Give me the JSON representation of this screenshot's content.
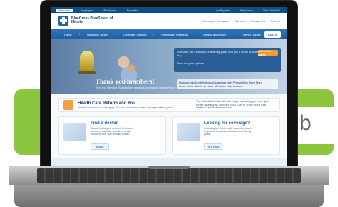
{
  "banner": {
    "letter": "b",
    "colors": {
      "green": "#8cc63f",
      "blue": "#1e5fa3"
    }
  },
  "browser": {
    "top_tabs": [
      "Welcome",
      "Employers",
      "Producers",
      "Providers"
    ],
    "top_right_links": [
      "en Español",
      "Feedback",
      "Text Size A A"
    ]
  },
  "header": {
    "logo_text": "BlueCross BlueShield of Illinois",
    "links": [
      "Company Information",
      "Careers",
      "Contact Us",
      "Search"
    ]
  },
  "nav": {
    "items": [
      "Home",
      "Insurance Basics",
      "Coverage Options",
      "Health and Wellness",
      "Already a Member?"
    ],
    "quotes": "Saved Quotes",
    "login": "Log In"
  },
  "hero": {
    "callout_text": "Compare our individual and family plans and get a quote quicker before you buy.",
    "cta": "Get a free quote",
    "plans_link": "View our plan options",
    "title": "Thank you members!",
    "subtitle": "\"Highest Member Satisfaction among Commercial Health Plans, Three Years in a Row\"",
    "medicare": "Now introducing Medicare Advantage with Prescription Drug Plan",
    "medicare_link": "Learn more about our other Medicare plan options."
  },
  "reform": {
    "title": "Health Care Reform and You",
    "subtitle": "Health insurance is changing. Do you know how these changes affect you?",
    "right_text": "The Affordable Care Act will begin impacting you and your family as early as October 2013. Get to know more with Health Care Reform and You."
  },
  "cards": [
    {
      "title": "Find a doctor",
      "text": "Search the largest network of doctors, dentists, hospitals, and other health providers with our Provider Finder.",
      "button": "search"
    },
    {
      "title": "Looking for coverage?",
      "text": "Choosing the right health insurance plan is important. Compare Individual and Family plans.",
      "button": "view plans"
    }
  ]
}
